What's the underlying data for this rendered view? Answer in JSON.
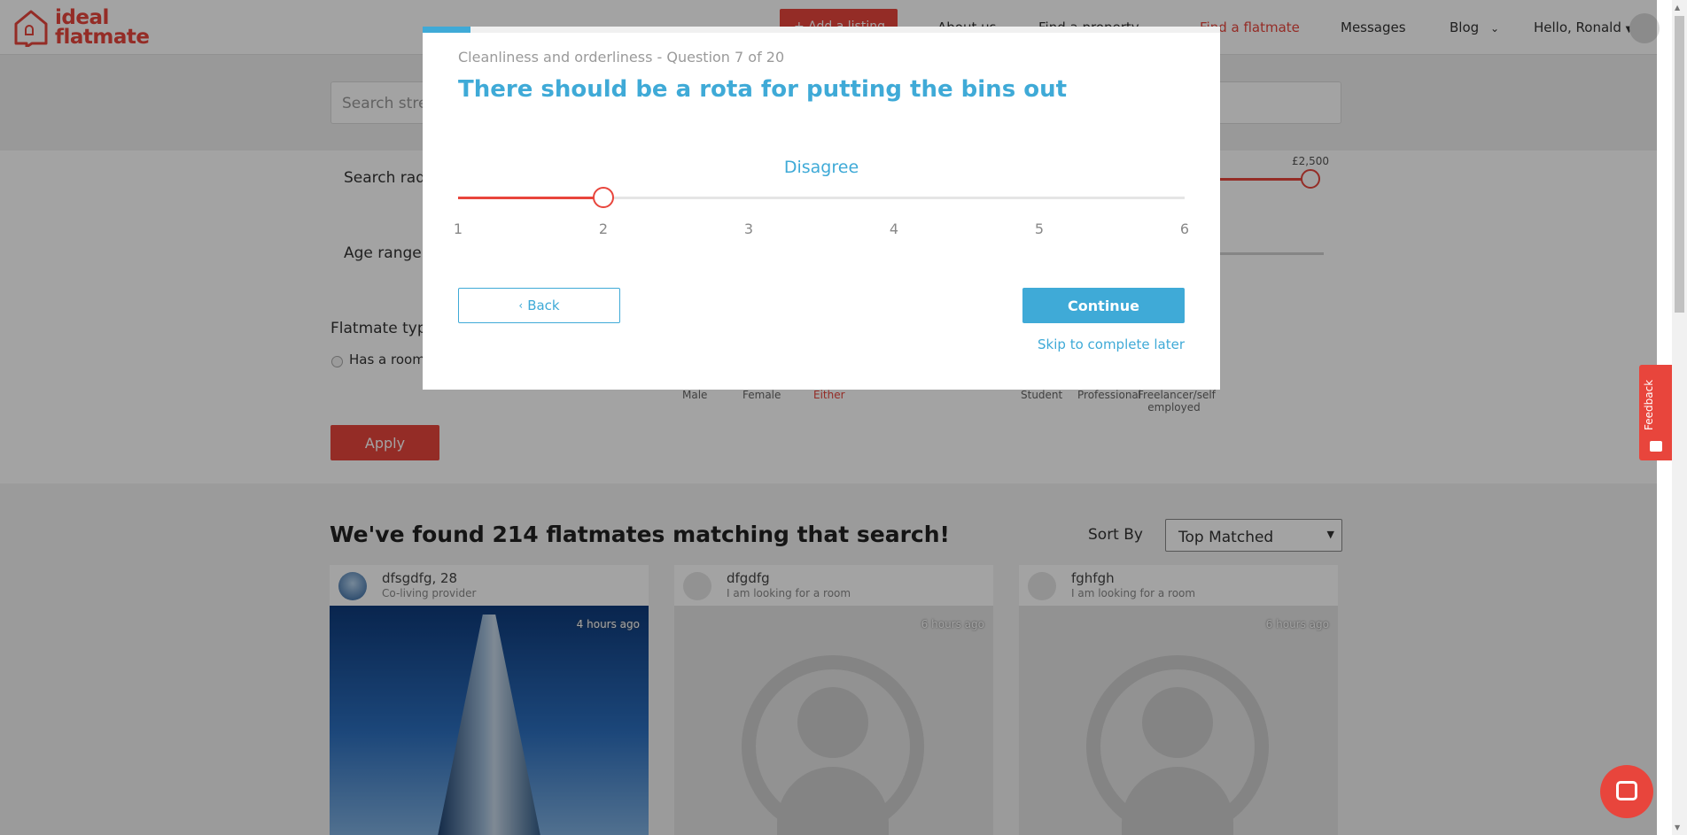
{
  "header": {
    "logo_line1": "ideal",
    "logo_line2": "flatmate",
    "add_listing": "+ Add a listing",
    "nav": [
      "About us",
      "Find a property",
      "Find a flatmate",
      "Messages",
      "Blog"
    ],
    "greeting": "Hello, Ronald"
  },
  "search": {
    "placeholder": "Search stre"
  },
  "filters": {
    "search_radius_label": "Search rad",
    "age_range_label": "Age range:",
    "price_max": "£2,500",
    "flatmate_type_label": "Flatmate type",
    "has_room_label": "Has a room",
    "gender_options": [
      "Male",
      "Female",
      "Either"
    ],
    "occupation_options": [
      "Student",
      "Professional",
      "Freelancer/self employed"
    ],
    "apply_label": "Apply"
  },
  "results": {
    "title": "We've found 214 flatmates matching that search!",
    "sort_label": "Sort By",
    "sort_value": "Top Matched",
    "cards": [
      {
        "name": "dfsgdfg, 28",
        "role": "Co-living provider",
        "time": "4 hours ago"
      },
      {
        "name": "dfgdfg",
        "role": "I am looking for a room",
        "time": "6 hours ago"
      },
      {
        "name": "fghfgh",
        "role": "I am looking for a room",
        "time": "6 hours ago"
      }
    ]
  },
  "feedback": {
    "label": "Feedback"
  },
  "modal": {
    "category": "Cleanliness and orderliness",
    "question_counter": "Question 7 of 20",
    "question_meta": "Cleanliness and orderliness - Question 7 of 20",
    "question_index": 7,
    "question_total": 20,
    "question": "There should be a rota for putting the bins out",
    "answer_label": "Disagree",
    "scale": [
      "1",
      "2",
      "3",
      "4",
      "5",
      "6"
    ],
    "selected_value": 2,
    "back_label": "Back",
    "continue_label": "Continue",
    "skip_label": "Skip to complete later"
  },
  "colors": {
    "brand_red": "#e8453c",
    "accent_blue": "#3faad7"
  },
  "icons": {
    "back": "chevron-left-icon",
    "blog": "chevron-down-icon",
    "greeting": "caret-down-icon",
    "sort": "caret-down-icon",
    "chat": "chat-icon",
    "feedback": "feedback-icon"
  }
}
